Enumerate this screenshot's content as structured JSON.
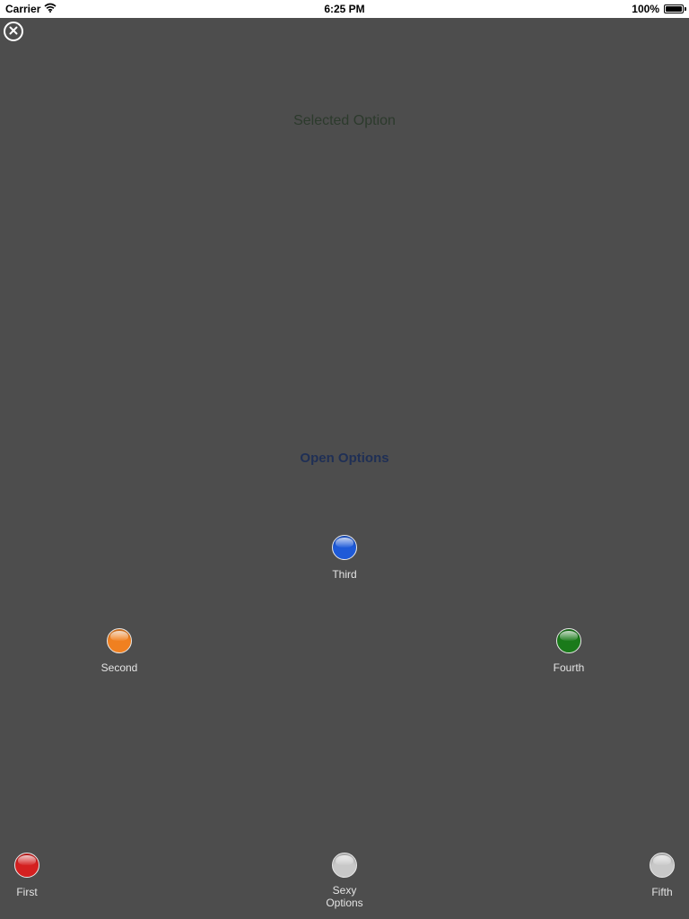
{
  "status_bar": {
    "carrier": "Carrier",
    "time": "6:25 PM",
    "battery_text": "100%",
    "battery_level": 1.0
  },
  "close_icon": "close-circle-icon",
  "selected_option_label": "Selected Option",
  "open_options_label": "Open Options",
  "options": {
    "first": {
      "label": "First",
      "color": "#d42020"
    },
    "second": {
      "label": "Second",
      "color": "#f08020"
    },
    "third": {
      "label": "Third",
      "color": "#1e5ad8"
    },
    "fourth": {
      "label": "Fourth",
      "color": "#1a7a1a"
    },
    "fifth": {
      "label": "Fifth",
      "color": "#c8c8c8"
    },
    "main": {
      "label": "Sexy\nOptions",
      "color": "#c8c8c8"
    }
  },
  "colors": {
    "background": "#4d4d4d",
    "selected_option_text": "#2c3a2c",
    "open_options_text": "#1f2f55"
  }
}
